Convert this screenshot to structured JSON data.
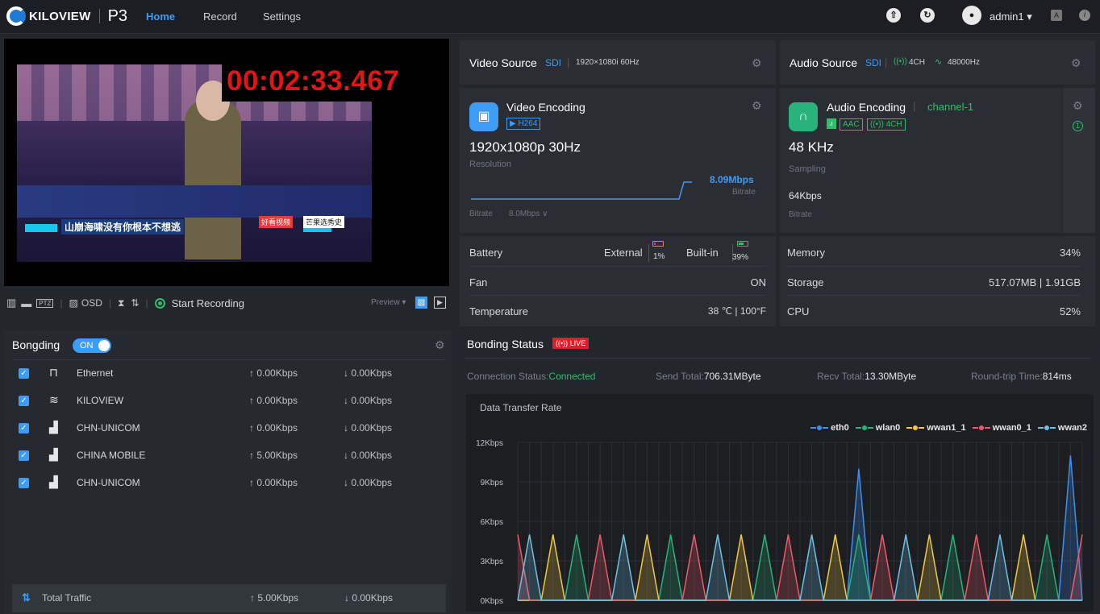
{
  "header": {
    "brand": "KILOVIEW",
    "model": "P3",
    "nav": [
      {
        "label": "Home"
      },
      {
        "label": "Record"
      },
      {
        "label": "Settings"
      }
    ],
    "user": "admin1 ▾"
  },
  "video": {
    "timecode": "00:02:33.467",
    "caption": "山崩海啸没有你根本不想逃",
    "logo_a": "好看视频",
    "logo_b": "芒果选秀史"
  },
  "toolbar": {
    "osd": "OSD",
    "start_recording": "Start Recording",
    "preview": "Preview ▾"
  },
  "video_source": {
    "title": "Video Source",
    "type": "SDI",
    "format": "1920×1080i 60Hz"
  },
  "audio_source": {
    "title": "Audio Source",
    "type": "SDI",
    "channels": "4CH",
    "rate": "48000Hz"
  },
  "video_encoding": {
    "title": "Video Encoding",
    "codec": "H264",
    "resolution": "1920x1080p 30Hz",
    "resolution_label": "Resolution",
    "bitrate_value": "8.09Mbps",
    "bitrate_label": "Bitrate",
    "bitrate_setting_label": "Bitrate",
    "bitrate_setting": "8.0Mbps ∨"
  },
  "audio_encoding": {
    "title": "Audio Encoding",
    "channel": "channel-1",
    "codec": "AAC",
    "channels": "4CH",
    "sampling": "48 KHz",
    "sampling_label": "Sampling",
    "bitrate": "64Kbps",
    "bitrate_label": "Bitrate"
  },
  "status": {
    "battery_label": "Battery",
    "external_label": "External",
    "external_pct": "1%",
    "builtin_label": "Built-in",
    "builtin_pct": "39%",
    "fan_label": "Fan",
    "fan_value": "ON",
    "temp_label": "Temperature",
    "temp_value": "38 ℃ | 100°F",
    "memory_label": "Memory",
    "memory_value": "34%",
    "storage_label": "Storage",
    "storage_value": "517.07MB | 1.91GB",
    "cpu_label": "CPU",
    "cpu_value": "52%"
  },
  "bonding": {
    "title": "Bongding",
    "toggle": "ON",
    "links": [
      {
        "name": "Ethernet",
        "up": "↑ 0.00Kbps",
        "down": "↓ 0.00Kbps",
        "icon": "ethernet-icon"
      },
      {
        "name": "KILOVIEW",
        "up": "↑ 0.00Kbps",
        "down": "↓ 0.00Kbps",
        "icon": "wifi-icon"
      },
      {
        "name": "CHN-UNICOM",
        "up": "↑ 0.00Kbps",
        "down": "↓ 0.00Kbps",
        "icon": "cellular-5g-icon"
      },
      {
        "name": "CHINA MOBILE",
        "up": "↑ 5.00Kbps",
        "down": "↓ 0.00Kbps",
        "icon": "cellular-5g-icon"
      },
      {
        "name": "CHN-UNICOM",
        "up": "↑ 0.00Kbps",
        "down": "↓ 0.00Kbps",
        "icon": "cellular-4g-icon"
      }
    ],
    "total_label": "Total Traffic",
    "total_up": "↑ 5.00Kbps",
    "total_down": "↓ 0.00Kbps"
  },
  "bonding_status": {
    "title": "Bonding Status",
    "live": "LIVE",
    "connection_label": "Connection Status:",
    "connection_value": "Connected",
    "send_label": "Send Total:",
    "send_value": "706.31MByte",
    "recv_label": "Recv Total:",
    "recv_value": "13.30MByte",
    "rtt_label": "Round-trip Time:",
    "rtt_value": "814ms"
  },
  "chart_data": {
    "type": "area",
    "title": "Data Transfer Rate",
    "ylim": [
      0,
      12
    ],
    "yticks": [
      "0Kbps",
      "3Kbps",
      "6Kbps",
      "9Kbps",
      "12Kbps"
    ],
    "legend_position": "top-right",
    "grid": true,
    "x_count": 49,
    "series": [
      {
        "name": "eth0",
        "color": "#3d8ef0",
        "peaks": [
          [
            29,
            10
          ],
          [
            47,
            11
          ]
        ]
      },
      {
        "name": "wlan0",
        "color": "#27b37a",
        "peaks": [
          [
            5,
            5
          ],
          [
            13,
            5
          ],
          [
            21,
            5
          ],
          [
            29,
            5
          ],
          [
            37,
            5
          ],
          [
            45,
            5
          ]
        ]
      },
      {
        "name": "wwan1_1",
        "color": "#f2c744",
        "peaks": [
          [
            3,
            5
          ],
          [
            11,
            5
          ],
          [
            19,
            5
          ],
          [
            27,
            5
          ],
          [
            35,
            5
          ],
          [
            43,
            5
          ]
        ]
      },
      {
        "name": "wwan0_1",
        "color": "#ef5a6a",
        "peaks": [
          [
            0,
            5
          ],
          [
            7,
            5
          ],
          [
            15,
            5
          ],
          [
            23,
            5
          ],
          [
            31,
            5
          ],
          [
            39,
            5
          ],
          [
            48,
            5
          ]
        ]
      },
      {
        "name": "wwan2",
        "color": "#6fc1e6",
        "peaks": [
          [
            1,
            5
          ],
          [
            9,
            5
          ],
          [
            17,
            5
          ],
          [
            25,
            5
          ],
          [
            33,
            5
          ],
          [
            41,
            5
          ]
        ]
      }
    ]
  }
}
